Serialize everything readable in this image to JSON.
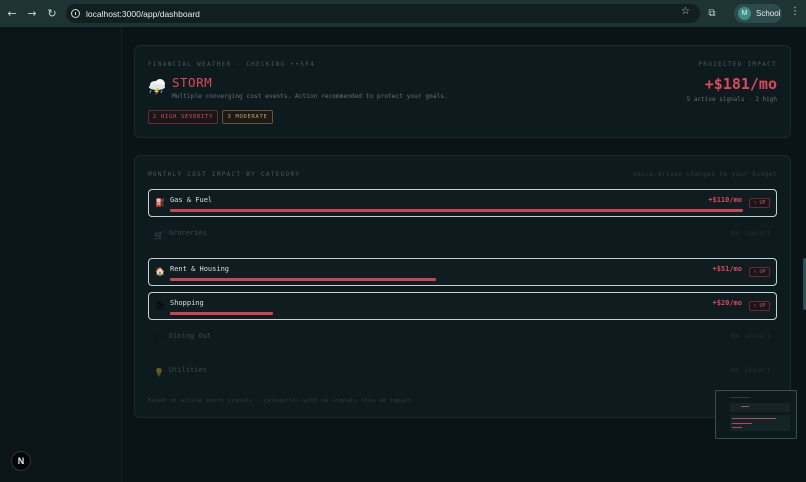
{
  "browser": {
    "url": "localhost:3000/app/dashboard",
    "profile_initial": "M",
    "profile_name": "School",
    "back_icon": "←",
    "forward_icon": "→",
    "reload_icon": "↻",
    "star_icon": "☆",
    "extensions_icon": "⧉",
    "menu_icon": "⋮"
  },
  "weather": {
    "label": "Financial weather · checking ••5F4",
    "status": "STORM",
    "description": "Multiple converging cost events. Action recommended to protect your goals.",
    "projected_label": "Projected impact",
    "projected_value": "+$181/mo",
    "projected_sub": "5 active signals · 2 high",
    "badges": {
      "high": "2 high severity",
      "moderate": "3 moderate"
    },
    "colors": {
      "storm": "#e0475a",
      "moderate": "#c9a35c"
    }
  },
  "impact": {
    "title": "Monthly cost impact by category",
    "hint": "macro-driven changes to your budget",
    "rows": [
      {
        "name": "Gas & Fuel",
        "icon": "⛽",
        "icon_name": "fuel-pump-icon",
        "amount": "+$110/mo",
        "trend": "↑ UP",
        "active": true,
        "share": 1.0
      },
      {
        "name": "Groceries",
        "icon": "🛒",
        "icon_name": "shopping-cart-icon",
        "amount": "No impact",
        "active": false
      },
      {
        "name": "Rent & Housing",
        "icon": "🏠",
        "icon_name": "house-icon",
        "amount": "+$51/mo",
        "trend": "↑ UP",
        "active": true,
        "share": 0.465
      },
      {
        "name": "Shopping",
        "icon": "🛍",
        "icon_name": "shopping-bag-icon",
        "amount": "+$20/mo",
        "trend": "↑ UP",
        "active": true,
        "share": 0.18
      },
      {
        "name": "Dining Out",
        "icon": "🍽",
        "icon_name": "fork-knife-icon",
        "amount": "No impact",
        "active": false
      },
      {
        "name": "Utilities",
        "icon": "💡",
        "icon_name": "lightbulb-icon",
        "amount": "No impact",
        "active": false
      }
    ],
    "footnote": "Based on active macro signals · categories with no signals show $0 impact"
  },
  "dev": {
    "badge_letter": "N"
  }
}
